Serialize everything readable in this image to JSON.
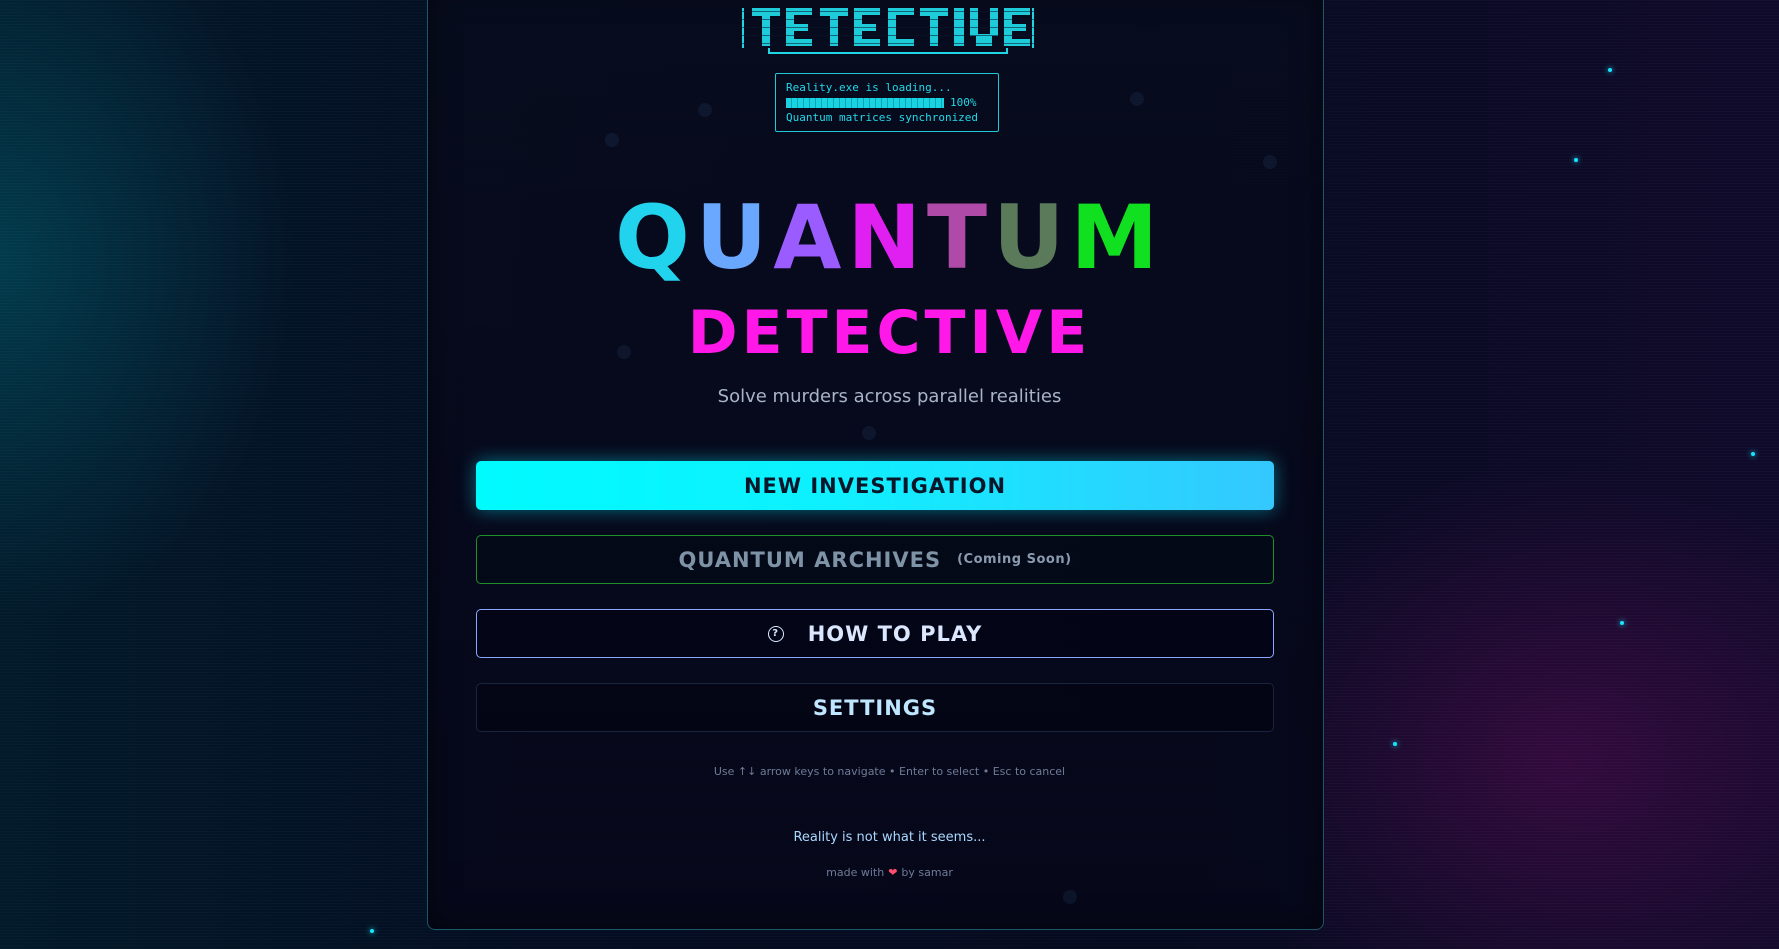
{
  "loader": {
    "line1": "Reality.exe is loading...",
    "progress_percent": 100,
    "progress_label": "100%",
    "line3": "Quantum matrices synchronized"
  },
  "title": {
    "quantum_letters": [
      "Q",
      "U",
      "A",
      "N",
      "T",
      "U",
      "M"
    ],
    "quantum_colors": [
      "#22d3ee",
      "#6aa8ff",
      "#9b5cff",
      "#e020f0",
      "#b04aa8",
      "#5a7a5a",
      "#10e020"
    ],
    "detective": "DETECTIVE",
    "tagline": "Solve murders across parallel realities"
  },
  "menu": {
    "new_investigation": "NEW INVESTIGATION",
    "quantum_archives": "QUANTUM ARCHIVES",
    "coming_soon": "(Coming Soon)",
    "how_to_play": "HOW TO PLAY",
    "how_to_play_icon": "help-circle-icon",
    "settings": "SETTINGS"
  },
  "footer": {
    "hint": "Use ↑↓ arrow keys to navigate • Enter to select • Esc to cancel",
    "motto": "Reality is not what it seems...",
    "credit_before": "made with",
    "credit_heart": "❤",
    "credit_after": "by samar"
  },
  "colors": {
    "accent_cyan": "#00fbff",
    "accent_magenta": "#ff18e8",
    "archives_border": "#1f8f2a"
  }
}
